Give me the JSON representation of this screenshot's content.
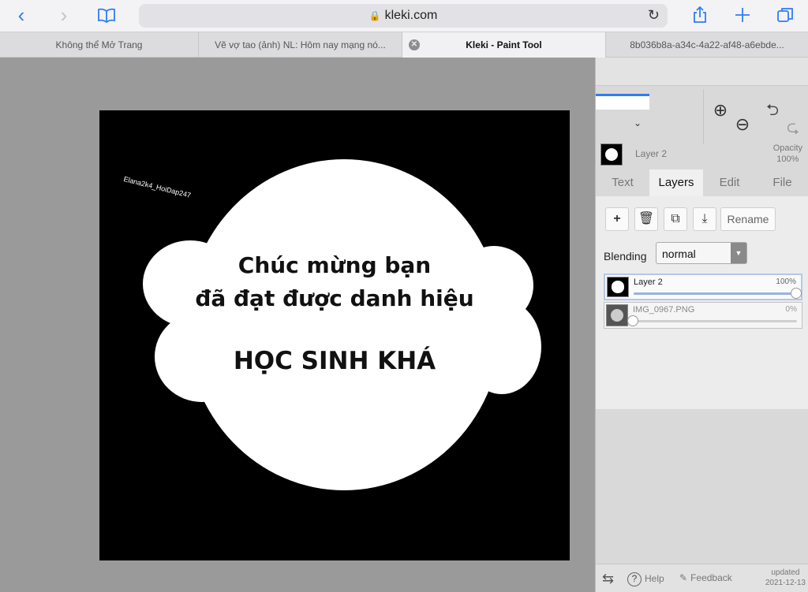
{
  "browser": {
    "url": "kleki.com",
    "tabs": [
      {
        "title": "Không thể Mở Trang"
      },
      {
        "title": "Vẽ vợ tao (ảnh) NL: Hôm nay mạng nó..."
      },
      {
        "title": "Kleki - Paint Tool"
      },
      {
        "title": "8b036b8a-a34c-4a22-af48-a6ebde..."
      }
    ],
    "icons": {
      "back": "chevron-left-icon",
      "forward": "chevron-right-icon",
      "bookmarks": "book-icon",
      "reload": "reload-icon",
      "share": "share-icon",
      "new_tab": "plus-icon",
      "tabs": "tabs-icon"
    }
  },
  "canvas": {
    "watermark": "Elana2k4_HoiDap247",
    "line1": "Chúc mừng bạn",
    "line2": "đã đạt được danh hiệu",
    "line3": "HỌC SINH KHÁ"
  },
  "panel": {
    "active_layer_name": "Layer 2",
    "opacity_label": "Opacity",
    "opacity_value": "100%",
    "tabs": [
      {
        "label": "Text"
      },
      {
        "label": "Layers"
      },
      {
        "label": "Edit"
      },
      {
        "label": "File"
      }
    ],
    "rename_label": "Rename",
    "blending_label": "Blending",
    "blending_value": "normal",
    "layers": [
      {
        "name": "Layer 2",
        "opacity": "100%",
        "opacity_fraction": 1.0
      },
      {
        "name": "IMG_0967.PNG",
        "opacity": "0%",
        "opacity_fraction": 0.0
      }
    ],
    "footer": {
      "help": "Help",
      "feedback": "Feedback",
      "updated_label": "updated",
      "updated_date": "2021-12-13"
    }
  },
  "colors": {
    "accent": "#2f7cf6",
    "canvas_bg": "#000000",
    "shape": "#ffffff"
  }
}
